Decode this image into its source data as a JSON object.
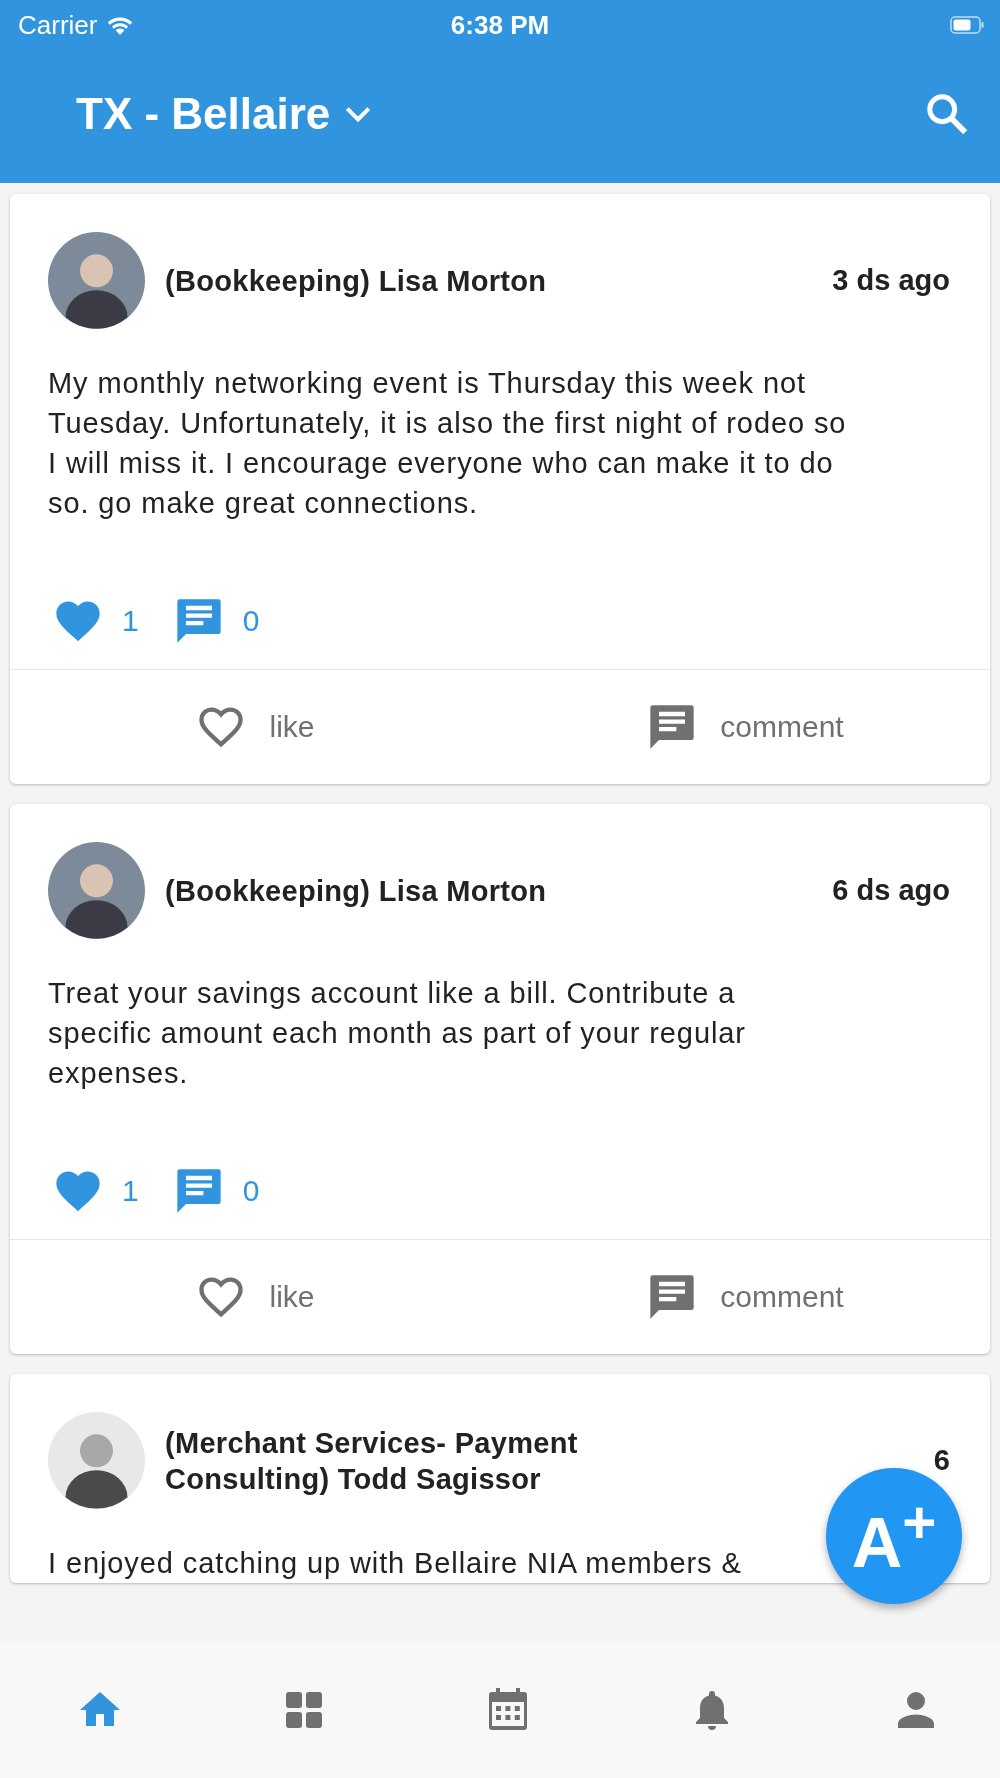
{
  "status_bar": {
    "carrier": "Carrier",
    "time": "6:38 PM"
  },
  "header": {
    "title": "TX - Bellaire"
  },
  "posts": [
    {
      "author": "(Bookkeeping) Lisa Morton",
      "time": "3 ds ago",
      "body": "My monthly networking event is Thursday this week not Tuesday. Unfortunately, it is also the first night of rodeo so I will miss it. I encourage everyone who can make it to do so. go make great connections.",
      "likes": "1",
      "comments": "0",
      "like_label": "like",
      "comment_label": "comment"
    },
    {
      "author": "(Bookkeeping) Lisa Morton",
      "time": "6 ds ago",
      "body": "Treat your savings account like a bill. Contribute a specific amount each month as part of your regular expenses.",
      "likes": "1",
      "comments": "0",
      "like_label": "like",
      "comment_label": "comment"
    },
    {
      "author": "(Merchant Services- Payment Consulting) Todd Sagissor",
      "time": "6",
      "body": "I enjoyed catching up with Bellaire NIA members &"
    }
  ],
  "fab": {
    "label": "A$^{+}$"
  },
  "nav": [
    {
      "kind": "home",
      "selected": true
    },
    {
      "kind": "grid",
      "selected": false
    },
    {
      "kind": "calendar",
      "selected": false
    },
    {
      "kind": "bell",
      "selected": false
    },
    {
      "kind": "person",
      "selected": false
    }
  ]
}
